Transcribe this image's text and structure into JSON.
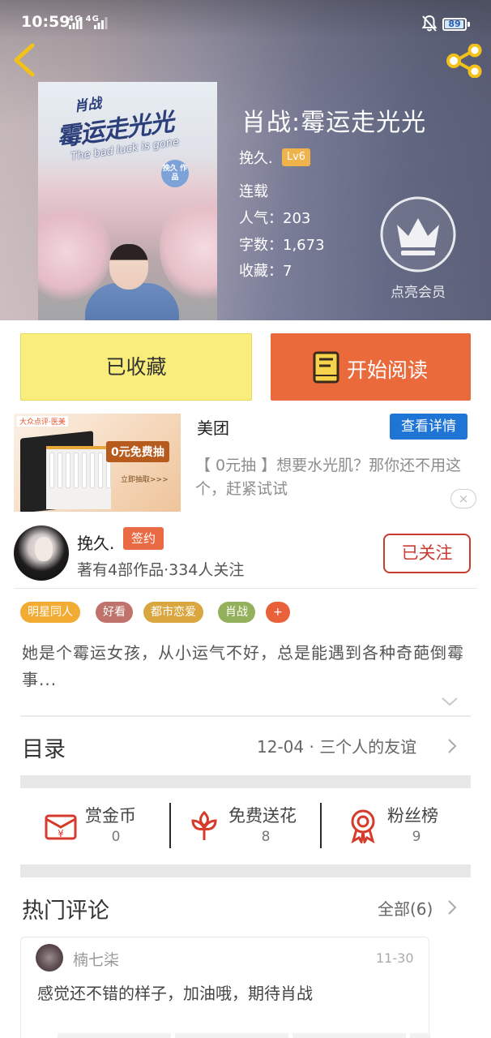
{
  "status_bar": {
    "time": "10:59",
    "network": "4G 4G",
    "battery": "89",
    "battery_level": 0.89
  },
  "book": {
    "title": "肖战:霉运走光光",
    "author": "挽久.",
    "level": "Lv6",
    "status": "连载",
    "popularity": "人气：203",
    "word_count": "字数：1,673",
    "favorites": "收藏：7",
    "cover": {
      "small_title": "肖战",
      "title": "霉运走光光",
      "subtitle": "The bad luck is gone",
      "seal": "挽久 作品"
    }
  },
  "vip": {
    "label": "点亮会员"
  },
  "actions": {
    "collected_label": "已收藏",
    "read_label": "开始阅读"
  },
  "ad": {
    "logo": "大众点评·医美",
    "tag": "0元免费抽",
    "link": "立即抽取>>>",
    "title": "美团",
    "detail_button": "查看详情",
    "description": "【 0元抽 】想要水光肌？那你还不用这个，赶紧试试",
    "close": "×"
  },
  "author_section": {
    "name": "挽久.",
    "badge": "签约",
    "stats": "著有4部作品·334人关注",
    "follow_label": "已关注"
  },
  "tags": [
    {
      "label": "明星同人",
      "color": "#f2ab33"
    },
    {
      "label": "好看",
      "color": "#c0736a"
    },
    {
      "label": "都市恋爱",
      "color": "#d9a63f"
    },
    {
      "label": "肖战",
      "color": "#93b05b"
    },
    {
      "label": "+",
      "color": "#e9613b"
    }
  ],
  "synopsis": "她是个霉运女孩，从小运气不好，总是能遇到各种奇葩倒霉事...",
  "toc": {
    "title": "目录",
    "latest": "12-04 · 三个人的友谊"
  },
  "stats": [
    {
      "label": "赏金币",
      "value": "0",
      "icon": "red-envelope-icon"
    },
    {
      "label": "免费送花",
      "value": "8",
      "icon": "flower-icon"
    },
    {
      "label": "粉丝榜",
      "value": "9",
      "icon": "award-ribbon-icon"
    }
  ],
  "comments": {
    "title": "热门评论",
    "all_label": "全部(6)",
    "items": [
      {
        "user": "楠七柒",
        "date": "11-30",
        "text": "感觉还不错的样子，加油哦，期待肖战"
      }
    ]
  },
  "colors": {
    "accent_orange": "#ea6a3c",
    "collected_yellow": "#f9ee7c",
    "follow_red": "#c73c2f",
    "ad_blue": "#1f75d6"
  }
}
